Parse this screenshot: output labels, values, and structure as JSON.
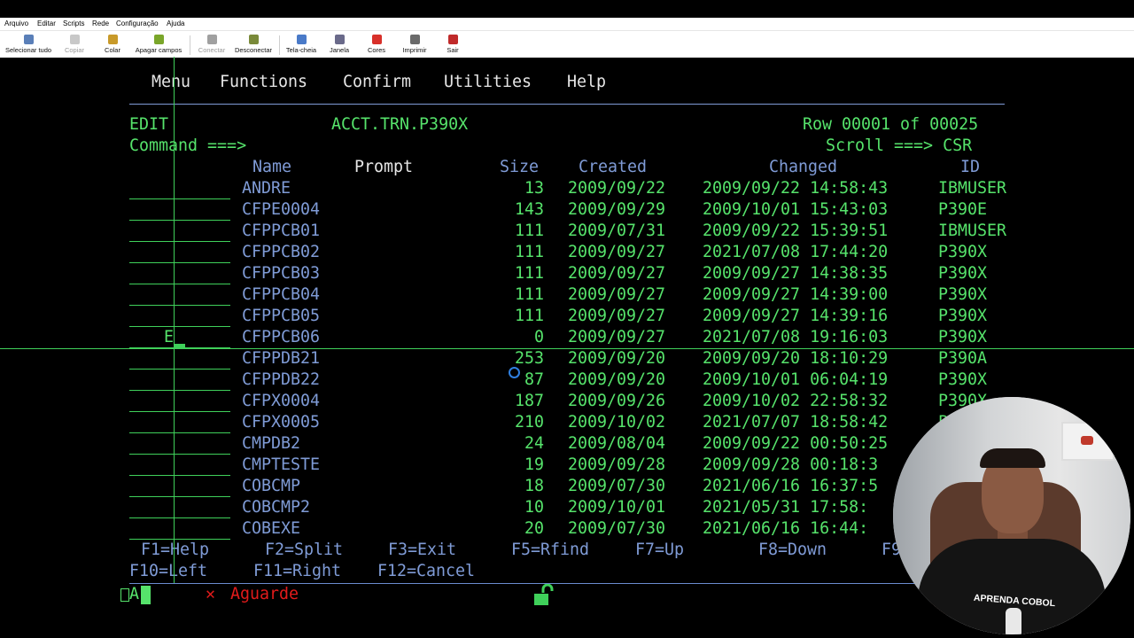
{
  "menubar": {
    "items": [
      "Arquivo",
      "Editar",
      "Scripts",
      "Rede",
      "Configuração",
      "Ajuda"
    ]
  },
  "toolbar": {
    "buttons": [
      {
        "label": "Selecionar tudo",
        "icon": "select-all-icon",
        "color": "#5a7fb8"
      },
      {
        "label": "Copiar",
        "icon": "copy-icon",
        "color": "#b8b8b8"
      },
      {
        "label": "Colar",
        "icon": "paste-icon",
        "color": "#c89a2a"
      },
      {
        "label": "Apagar campos",
        "icon": "erase-fields-icon",
        "color": "#7aa62a"
      },
      {
        "label": "Conectar",
        "icon": "connect-icon",
        "color": "#a0a0a0"
      },
      {
        "label": "Desconectar",
        "icon": "disconnect-icon",
        "color": "#7a8a3a"
      },
      {
        "label": "Tela-cheia",
        "icon": "fullscreen-icon",
        "color": "#4a7ac8"
      },
      {
        "label": "Janela",
        "icon": "window-icon",
        "color": "#6a6a8a"
      },
      {
        "label": "Cores",
        "icon": "colors-icon",
        "color": "#d8302a"
      },
      {
        "label": "Imprimir",
        "icon": "print-icon",
        "color": "#6a6a6a"
      },
      {
        "label": "Sair",
        "icon": "exit-icon",
        "color": "#c02a2a"
      }
    ]
  },
  "actionbar": {
    "items": [
      "Menu",
      "Functions",
      "Confirm",
      "Utilities",
      "Help"
    ]
  },
  "header": {
    "mode": "EDIT",
    "dataset": "ACCT.TRN.P390X",
    "row_info": "Row 00001 of 00025",
    "command_label": "Command ===>",
    "scroll_label": "Scroll ===> CSR"
  },
  "columns": {
    "name": "Name",
    "prompt": "Prompt",
    "size": "Size",
    "created": "Created",
    "changed": "Changed",
    "id": "ID"
  },
  "members": [
    {
      "cmd": "",
      "name": "ANDRE",
      "size": "13",
      "created": "2009/09/22",
      "changed": "2009/09/22 14:58:43",
      "id": "IBMUSER"
    },
    {
      "cmd": "",
      "name": "CFPE0004",
      "size": "143",
      "created": "2009/09/29",
      "changed": "2009/10/01 15:43:03",
      "id": "P390E"
    },
    {
      "cmd": "",
      "name": "CFPPCB01",
      "size": "111",
      "created": "2009/07/31",
      "changed": "2009/09/22 15:39:51",
      "id": "IBMUSER"
    },
    {
      "cmd": "",
      "name": "CFPPCB02",
      "size": "111",
      "created": "2009/09/27",
      "changed": "2021/07/08 17:44:20",
      "id": "P390X"
    },
    {
      "cmd": "",
      "name": "CFPPCB03",
      "size": "111",
      "created": "2009/09/27",
      "changed": "2009/09/27 14:38:35",
      "id": "P390X"
    },
    {
      "cmd": "",
      "name": "CFPPCB04",
      "size": "111",
      "created": "2009/09/27",
      "changed": "2009/09/27 14:39:00",
      "id": "P390X"
    },
    {
      "cmd": "",
      "name": "CFPPCB05",
      "size": "111",
      "created": "2009/09/27",
      "changed": "2009/09/27 14:39:16",
      "id": "P390X"
    },
    {
      "cmd": "E",
      "name": "CFPPCB06",
      "size": "0",
      "created": "2009/09/27",
      "changed": "2021/07/08 19:16:03",
      "id": "P390X"
    },
    {
      "cmd": "",
      "name": "CFPPDB21",
      "size": "253",
      "created": "2009/09/20",
      "changed": "2009/09/20 18:10:29",
      "id": "P390A"
    },
    {
      "cmd": "",
      "name": "CFPPDB22",
      "size": "87",
      "created": "2009/09/20",
      "changed": "2009/10/01 06:04:19",
      "id": "P390X"
    },
    {
      "cmd": "",
      "name": "CFPX0004",
      "size": "187",
      "created": "2009/09/26",
      "changed": "2009/10/02 22:58:32",
      "id": "P390X"
    },
    {
      "cmd": "",
      "name": "CFPX0005",
      "size": "210",
      "created": "2009/10/02",
      "changed": "2021/07/07 18:58:42",
      "id": "P"
    },
    {
      "cmd": "",
      "name": "CMPDB2",
      "size": "24",
      "created": "2009/08/04",
      "changed": "2009/09/22 00:50:25",
      "id": ""
    },
    {
      "cmd": "",
      "name": "CMPTESTE",
      "size": "19",
      "created": "2009/09/28",
      "changed": "2009/09/28 00:18:3",
      "id": ""
    },
    {
      "cmd": "",
      "name": "COBCMP",
      "size": "18",
      "created": "2009/07/30",
      "changed": "2021/06/16 16:37:5",
      "id": ""
    },
    {
      "cmd": "",
      "name": "COBCMP2",
      "size": "10",
      "created": "2009/10/01",
      "changed": "2021/05/31 17:58:",
      "id": ""
    },
    {
      "cmd": "",
      "name": "COBEXE",
      "size": "20",
      "created": "2009/07/30",
      "changed": "2021/06/16 16:44:",
      "id": ""
    }
  ],
  "pfkeys": {
    "row1": [
      "F1=Help",
      "F2=Split",
      "F3=Exit",
      "F5=Rfind",
      "F7=Up",
      "F8=Down",
      "F9"
    ],
    "row2": [
      "F10=Left",
      "F11=Right",
      "F12=Cancel"
    ]
  },
  "oia": {
    "indicator": "A",
    "status": "Aguarde"
  },
  "webcam": {
    "shirt_text": "APRENDA COBOL"
  },
  "colors": {
    "field_green": "#56e36b",
    "label_blue": "#7f9bd6",
    "status_red": "#e21b1b"
  }
}
